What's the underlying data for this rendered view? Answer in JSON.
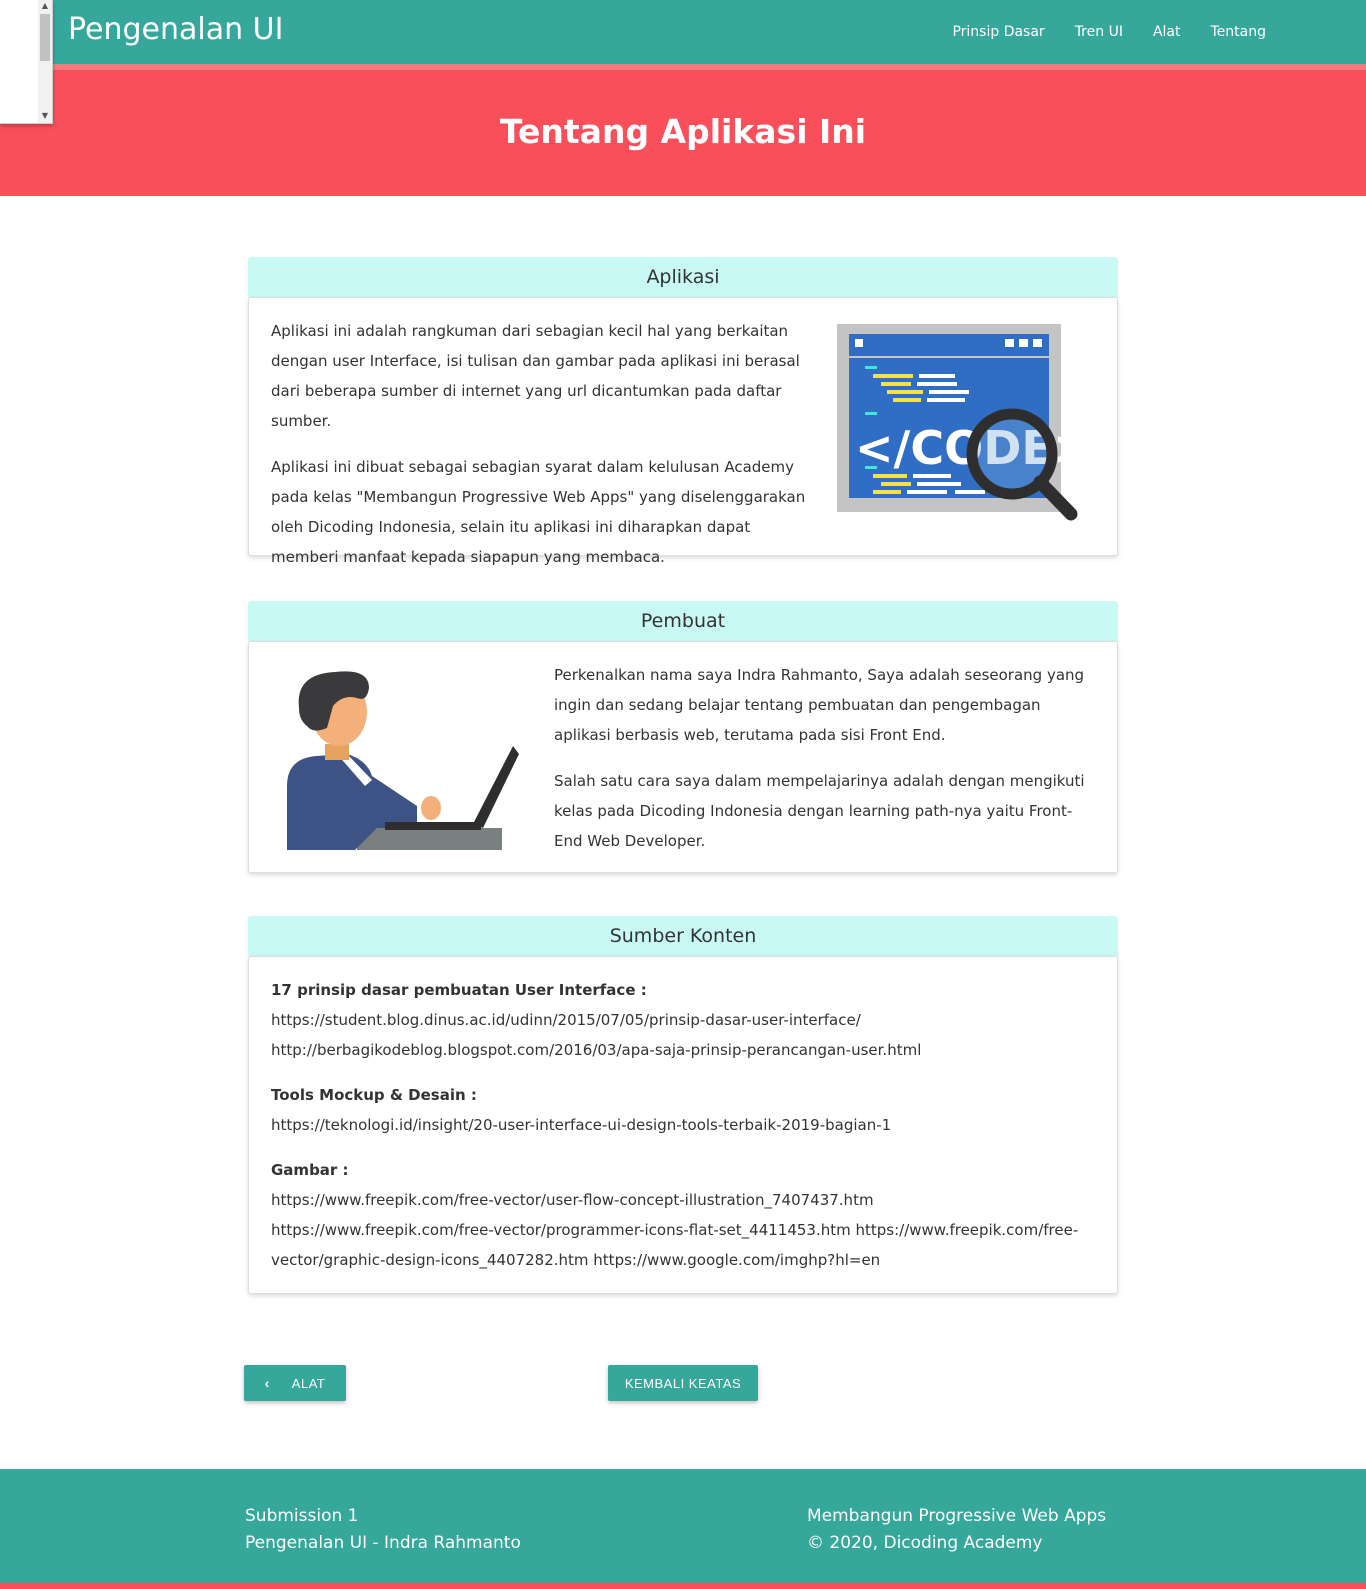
{
  "navbar": {
    "brand": "Pengenalan UI",
    "links": [
      "Prinsip Dasar",
      "Tren UI",
      "Alat",
      "Tentang"
    ]
  },
  "hero": {
    "title": "Tentang Aplikasi Ini"
  },
  "aplikasi": {
    "heading": "Aplikasi",
    "paragraphs": [
      "Aplikasi ini adalah rangkuman dari sebagian kecil hal yang berkaitan dengan user Interface, isi tulisan dan gambar pada aplikasi ini berasal dari beberapa sumber di internet yang url dicantumkan pada daftar sumber.",
      "Aplikasi ini dibuat sebagai sebagian syarat dalam kelulusan Academy pada kelas \"Membangun Progressive Web Apps\" yang diselenggarakan oleh Dicoding Indonesia, selain itu aplikasi ini diharapkan dapat memberi manfaat kepada siapapun yang membaca."
    ],
    "image_icon": "code-search-icon"
  },
  "pembuat": {
    "heading": "Pembuat",
    "paragraphs": [
      "Perkenalkan nama saya Indra Rahmanto, Saya adalah seseorang yang ingin dan sedang belajar tentang pembuatan dan pengembagan aplikasi berbasis web, terutama pada sisi Front End.",
      "Salah satu cara saya dalam mempelajarinya adalah dengan mengikuti kelas pada Dicoding Indonesia dengan learning path-nya yaitu Front-End Web Developer."
    ],
    "image_icon": "programmer-icon"
  },
  "sumber": {
    "heading": "Sumber Konten",
    "groups": [
      {
        "title": "17 prinsip dasar pembuatan User Interface :",
        "links": [
          "https://student.blog.dinus.ac.id/udinn/2015/07/05/prinsip-dasar-user-interface/",
          "http://berbagikodeblog.blogspot.com/2016/03/apa-saja-prinsip-perancangan-user.html"
        ]
      },
      {
        "title": "Tools Mockup & Desain :",
        "links": [
          "https://teknologi.id/insight/20-user-interface-ui-design-tools-terbaik-2019-bagian-1"
        ]
      },
      {
        "title": "Gambar :",
        "links": [
          "https://www.freepik.com/free-vector/user-flow-concept-illustration_7407437.htm https://www.freepik.com/free-vector/programmer-icons-flat-set_4411453.htm https://www.freepik.com/free-vector/graphic-design-icons_4407282.htm https://www.google.com/imghp?hl=en"
        ]
      }
    ]
  },
  "buttons": {
    "back": "ALAT",
    "top": "KEMBALI KEATAS"
  },
  "footer": {
    "left": [
      "Submission 1",
      "Pengenalan UI - Indra Rahmanto"
    ],
    "right": [
      "Membangun Progressive Web Apps",
      "© 2020, Dicoding Academy"
    ]
  },
  "colors": {
    "primary": "#35a79b",
    "accent": "#f94f5b",
    "card_header": "#c8f9f4"
  }
}
